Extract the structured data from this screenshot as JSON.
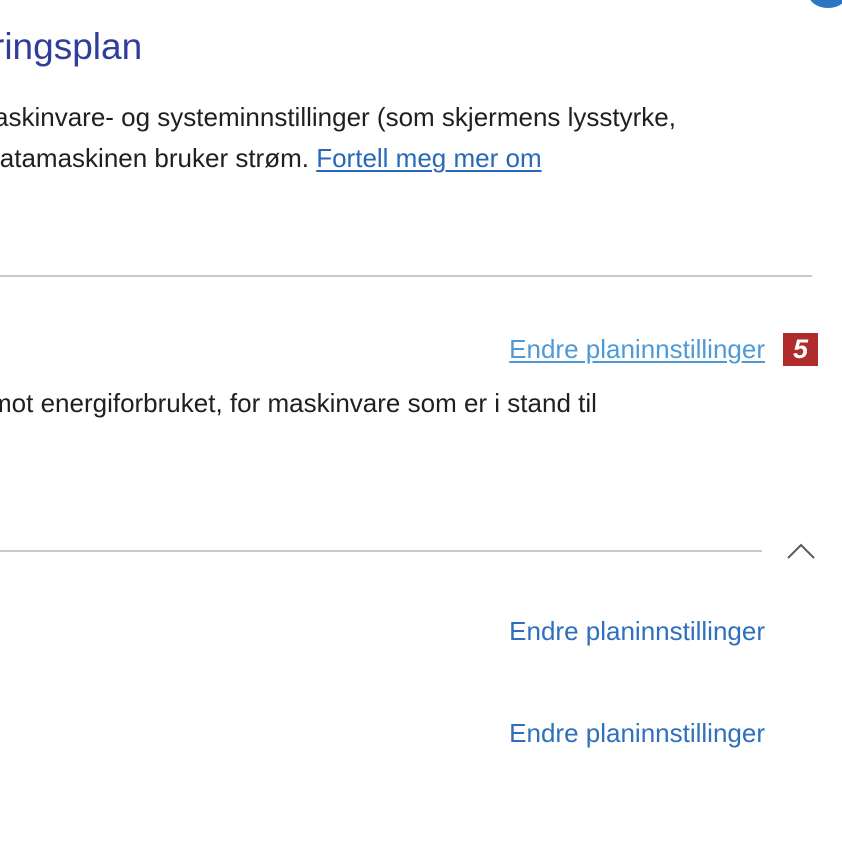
{
  "header": {
    "title": "ringsplan"
  },
  "description": {
    "line1": "askinvare- og systeminnstillinger (som skjermens lysstyrke,",
    "line2_text": "latamaskinen bruker strøm. ",
    "line2_link": "Fortell meg mer om"
  },
  "plan_section": {
    "change_link": "Endre planinnstillinger",
    "step_marker": "5",
    "description": "mot energiforbruket, for maskinvare som er i stand til"
  },
  "more_plans": {
    "collapse_icon": "chevron-up-icon",
    "items": [
      {
        "change_link": "Endre planinnstillinger"
      },
      {
        "change_link": "Endre planinnstillinger"
      }
    ]
  },
  "colors": {
    "title": "#2f3d9b",
    "link": "#2868b8",
    "link_visited": "#4e9ad8",
    "marker_bg": "#b02b2b",
    "divider": "#c9c9c9"
  }
}
